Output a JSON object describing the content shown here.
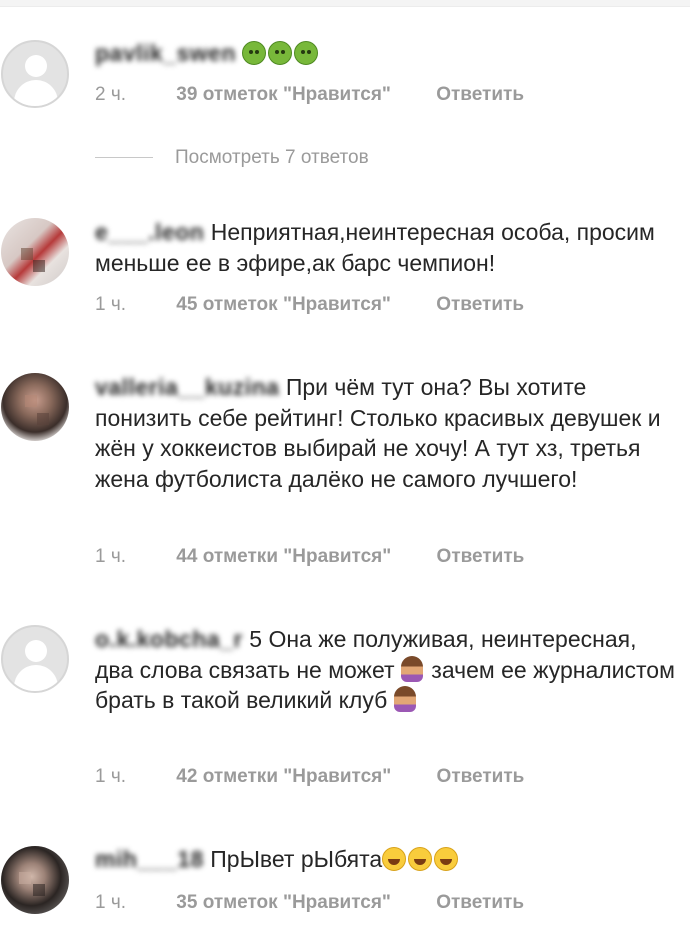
{
  "view_replies": "Посмотреть 7 ответов",
  "reply_label": "Ответить",
  "comments": [
    {
      "username": "pavlik_swen",
      "text": "",
      "emoji": [
        "sick-face-emoji",
        "sick-face-emoji",
        "sick-face-emoji"
      ],
      "time": "2 ч.",
      "likes": "39 отметок \"Нравится\""
    },
    {
      "username": "e___.leon",
      "text": "Неприятная,неинтересная особа, просим меньше ее в эфире,ак барс чемпион!",
      "time": "1 ч.",
      "likes": "45 отметок \"Нравится\""
    },
    {
      "username": "valleria__kuzina",
      "text": "При чём тут она? Вы хотите понизить себе рейтинг! Столько красивых девушек и жён у хоккеистов выбирай не хочу! А тут хз, третья жена футболиста далёко не самого лучшего!",
      "time": "1 ч.",
      "likes": "44 отметки \"Нравится\""
    },
    {
      "username": "o.k.kobcha_r",
      "text_parts": [
        "5 Она же полуживая, неинтересная, два слова связать не может",
        "зачем ее журналистом брать в такой великий клуб"
      ],
      "time": "1 ч.",
      "likes": "42 отметки \"Нравится\""
    },
    {
      "username": "mih___18",
      "text": "ПрЫвет рЫбята",
      "emoji": [
        "laughing-emoji",
        "laughing-emoji",
        "laughing-emoji"
      ],
      "time": "1 ч.",
      "likes": "35 отметок \"Нравится\""
    }
  ]
}
